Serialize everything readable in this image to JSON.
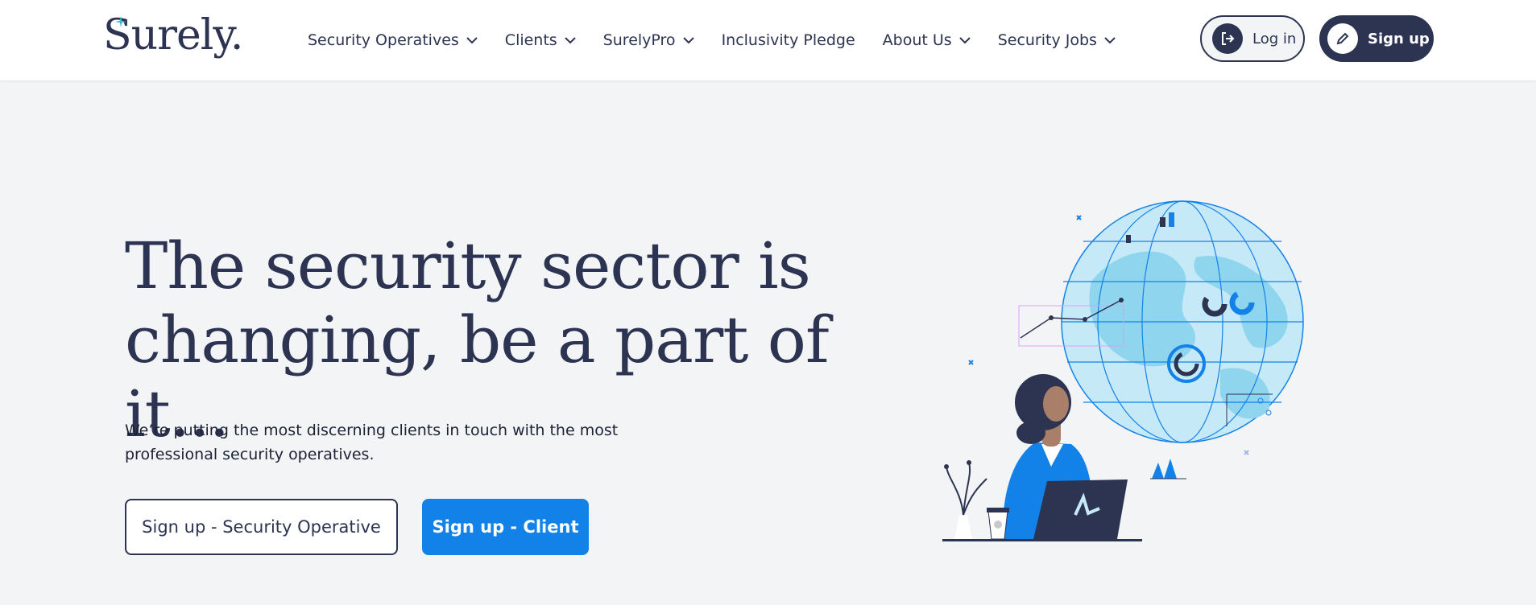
{
  "brand": {
    "logo_text": "Surely.",
    "accent_color": "#1382e8",
    "dark_color": "#2d3452"
  },
  "nav": {
    "items": [
      {
        "label": "Security Operatives",
        "has_dropdown": true
      },
      {
        "label": "Clients",
        "has_dropdown": true
      },
      {
        "label": "SurelyPro",
        "has_dropdown": true
      },
      {
        "label": "Inclusivity Pledge",
        "has_dropdown": false
      },
      {
        "label": "About Us",
        "has_dropdown": true
      },
      {
        "label": "Security Jobs",
        "has_dropdown": true
      }
    ]
  },
  "auth": {
    "login_label": "Log in",
    "login_icon": "login-icon",
    "signup_label": "Sign up",
    "signup_icon": "pencil-icon"
  },
  "hero": {
    "title_line1": "The security sector is",
    "title_line2": "changing, be a part of it...",
    "subtitle": "We’re putting the most discerning clients in touch with the most professional security operatives.",
    "cta_operative": "Sign up - Security Operative",
    "cta_client": "Sign up - Client"
  }
}
